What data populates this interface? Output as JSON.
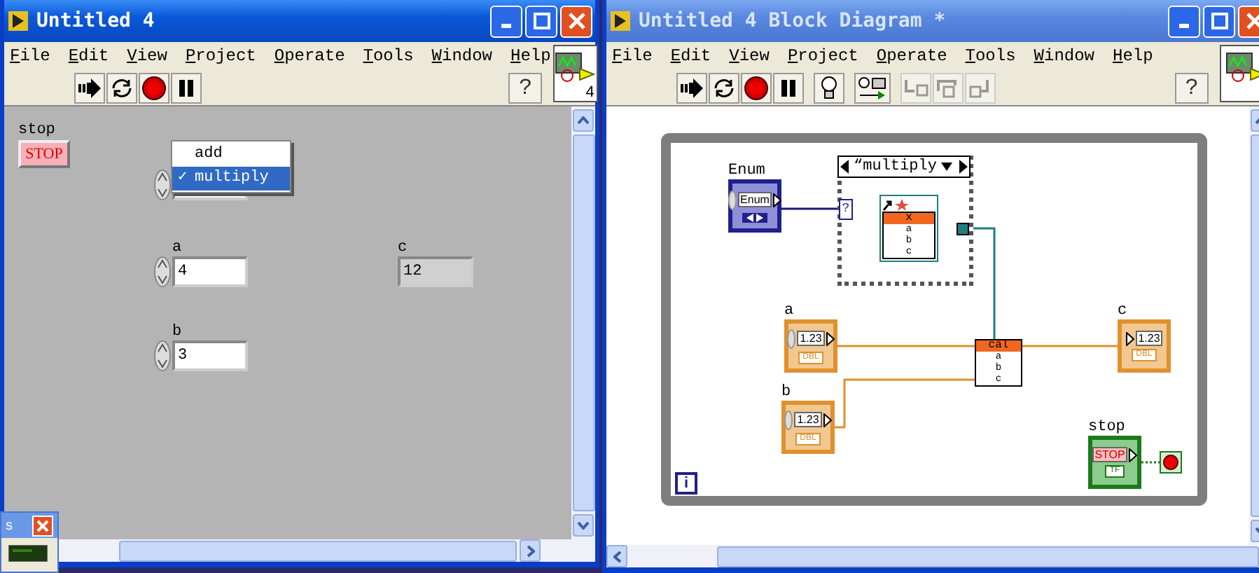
{
  "front_panel": {
    "window": {
      "title": "Untitled 4",
      "active": true
    },
    "menu": [
      "File",
      "Edit",
      "View",
      "Project",
      "Operate",
      "Tools",
      "Window",
      "Help"
    ],
    "help": "?",
    "connector_label": "4",
    "controls": [
      {
        "kind": "button",
        "label": "stop",
        "value": "STOP"
      },
      {
        "kind": "enum"
      },
      {
        "kind": "numeric",
        "indicator": false,
        "label": "a",
        "value": "4"
      },
      {
        "kind": "numeric",
        "indicator": true,
        "label": "c",
        "value": "12"
      },
      {
        "kind": "numeric",
        "indicator": false,
        "label": "b",
        "value": "3"
      }
    ],
    "popup_menu": [
      {
        "label": "add",
        "selected": false
      },
      {
        "label": "multiply",
        "selected": true,
        "mark": "✓"
      }
    ],
    "palette": {
      "title": "s"
    }
  },
  "block_diagram": {
    "window": {
      "title": "Untitled 4 Block Diagram *",
      "active": false
    },
    "menu": [
      "File",
      "Edit",
      "View",
      "Project",
      "Operate",
      "Tools",
      "Window",
      "Help"
    ],
    "help": "?",
    "terminals": [
      {
        "kind": "enum",
        "indicator": false,
        "label": "Enum",
        "value": "Enum"
      },
      {
        "kind": "numeric",
        "indicator": false,
        "label": "a",
        "value": "1.23",
        "type": "DBL"
      },
      {
        "kind": "numeric",
        "indicator": false,
        "label": "b",
        "value": "1.23",
        "type": "DBL"
      },
      {
        "kind": "numeric",
        "indicator": true,
        "label": "c",
        "value": "1.23",
        "type": "DBL"
      },
      {
        "kind": "boolean",
        "indicator": false,
        "label": "stop",
        "value": "STOP",
        "type": "TF"
      }
    ],
    "case_structure": {
      "selector": "“multiply",
      "selector_terminal": "?",
      "node": {
        "header": "x",
        "rows": [
          "a",
          "b",
          "c"
        ]
      }
    },
    "node": {
      "header": "cal",
      "rows": [
        "a",
        "b",
        "c"
      ]
    },
    "loop_iteration": "i"
  }
}
